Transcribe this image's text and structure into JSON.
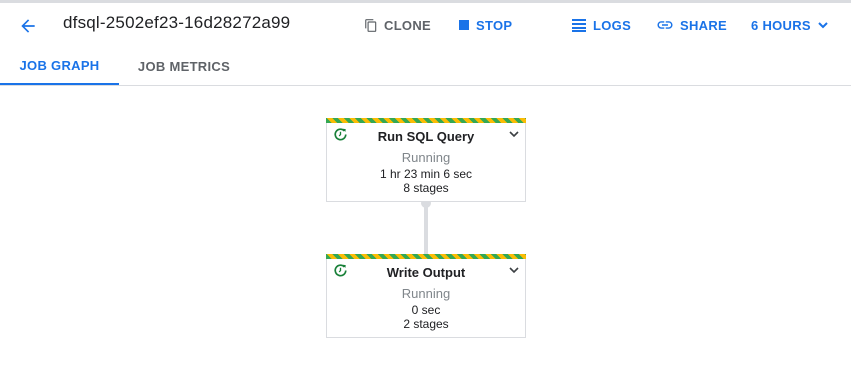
{
  "header": {
    "job_name": "dfsql-2502ef23-16d28272a99",
    "actions": {
      "clone": "CLONE",
      "stop": "STOP",
      "logs": "LOGS",
      "share": "SHARE",
      "time_range": "6 HOURS"
    }
  },
  "tabs": [
    {
      "label": "JOB GRAPH",
      "active": true
    },
    {
      "label": "JOB METRICS",
      "active": false
    }
  ],
  "graph": {
    "nodes": [
      {
        "title": "Run SQL Query",
        "state": "Running",
        "duration": "1 hr 23 min 6 sec",
        "stages": "8 stages"
      },
      {
        "title": "Write Output",
        "state": "Running",
        "duration": "0 sec",
        "stages": "2 stages"
      }
    ]
  },
  "colors": {
    "accent": "#1a73e8",
    "running_green": "#34a853",
    "running_yellow": "#fbbc04",
    "status_icon": "#188038"
  },
  "icons": {
    "back": "arrow-back-icon",
    "clone": "copy-icon",
    "stop": "stop-square-icon",
    "logs": "list-lines-icon",
    "share": "link-icon",
    "dropdown": "chevron-down-icon",
    "node_status": "running-refresh-icon",
    "node_expand": "chevron-down-icon"
  }
}
